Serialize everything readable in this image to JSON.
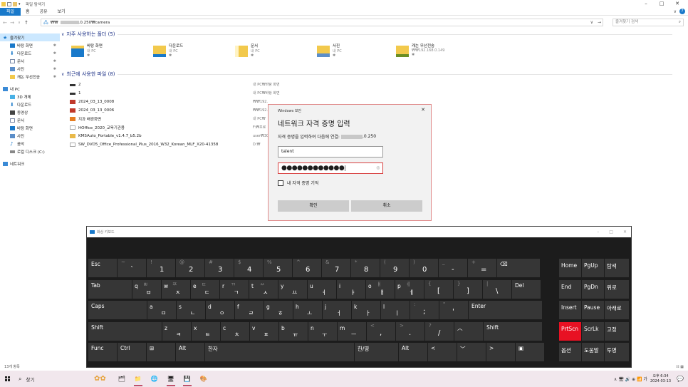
{
  "window": {
    "title": "파일 탐색기",
    "controls": [
      "–",
      "□",
      "✕"
    ]
  },
  "ribbon": {
    "tabs": [
      "파일",
      "홈",
      "공유",
      "보기"
    ],
    "expand": "∨",
    "help": "?"
  },
  "nav": {
    "back": "←",
    "forward": "→",
    "recent": "∨",
    "up": "↑",
    "address_prefix": "₩₩",
    "address_suffix": ".0.250₩camera",
    "dropdown": "∨",
    "refresh": "→",
    "search_placeholder": "즐겨찾기 검색",
    "search_icon": "⌕"
  },
  "sidebar": {
    "quick_access": "즐겨찾기",
    "quick_items": [
      "바탕 화면",
      "다운로드",
      "문서",
      "사진",
      "캐논 무선전송"
    ],
    "pin": "✱",
    "this_pc": "내 PC",
    "pc_items": [
      "3D 개체",
      "다운로드",
      "동영상",
      "문서",
      "바탕 화면",
      "사진",
      "음악",
      "로컬 디스크 (C:)"
    ],
    "network": "네트워크"
  },
  "frequent": {
    "header": "자주 사용하는 폴더 (5)",
    "folders": [
      {
        "name": "바탕 화면",
        "loc": "내 PC"
      },
      {
        "name": "다운로드",
        "loc": "내 PC"
      },
      {
        "name": "문서",
        "loc": "내 PC"
      },
      {
        "name": "사진",
        "loc": "내 PC"
      },
      {
        "name": "캐논 무선전송",
        "loc": "₩₩192.168.0.149"
      }
    ]
  },
  "recent": {
    "header": "최근에 사용한 파일 (8)",
    "files": [
      {
        "name": "2",
        "loc": "내 PC₩바탕 화면"
      },
      {
        "name": "1",
        "loc": "내 PC₩바탕 화면"
      },
      {
        "name": "2024_03_13_0008",
        "loc": "₩₩192."
      },
      {
        "name": "2024_03_13_0006",
        "loc": "₩₩192."
      },
      {
        "name": "지과 배경화면",
        "loc": "내 PC₩"
      },
      {
        "name": "HOffice_2020_교육기관용",
        "loc": "F:₩프로"
      },
      {
        "name": "KMSAuto_Portable_v1.4.7_b5.2b",
        "loc": "user₩30"
      },
      {
        "name": "SW_DVD5_Office_Professional_Plus_2016_W32_Korean_MLF_X20-41358",
        "loc": "D:₩"
      }
    ]
  },
  "status": {
    "count": "13개 항목",
    "views": "☷ ▦"
  },
  "dialog": {
    "title": "Windows 보안",
    "close": "✕",
    "heading": "네트워크 자격 증명 입력",
    "subtitle_prefix": "자격 증명을 입력하여 다음에 연결:",
    "subtitle_suffix": ".0.250",
    "username": "talent",
    "password_mask": "●●●●●●●●●●●●",
    "eye": "◎",
    "remember": "내 자격 증명 기억",
    "ok": "확인",
    "cancel": "취소"
  },
  "osk": {
    "title": "화상 키보드",
    "controls": [
      "–",
      "□",
      "✕"
    ],
    "rows": [
      [
        {
          "lbl": "Esc",
          "w": 40
        },
        {
          "sh": "~",
          "mn": "`",
          "w": 40
        },
        {
          "sh": "!",
          "mn": "1",
          "w": 40
        },
        {
          "sh": "@",
          "mn": "2",
          "w": 40
        },
        {
          "sh": "#",
          "mn": "3",
          "w": 40
        },
        {
          "sh": "$",
          "mn": "4",
          "w": 40
        },
        {
          "sh": "%",
          "mn": "5",
          "w": 40
        },
        {
          "sh": "^",
          "mn": "6",
          "w": 40
        },
        {
          "sh": "&",
          "mn": "7",
          "w": 40
        },
        {
          "sh": "*",
          "mn": "8",
          "w": 40
        },
        {
          "sh": "(",
          "mn": "9",
          "w": 40
        },
        {
          "sh": ")",
          "mn": "0",
          "w": 40
        },
        {
          "sh": "_",
          "mn": "-",
          "w": 40
        },
        {
          "sh": "+",
          "mn": "=",
          "w": 40
        },
        {
          "lbl": "⌫",
          "w": 60
        }
      ],
      [
        {
          "lbl": "Tab",
          "w": 61
        },
        {
          "lt": "q",
          "sh": "ㅃ",
          "hg": "ㅂ",
          "w": 40
        },
        {
          "lt": "w",
          "sh": "ㅉ",
          "hg": "ㅈ",
          "w": 40
        },
        {
          "lt": "e",
          "sh": "ㄸ",
          "hg": "ㄷ",
          "w": 40
        },
        {
          "lt": "r",
          "sh": "ㄲ",
          "hg": "ㄱ",
          "w": 40
        },
        {
          "lt": "t",
          "sh": "ㅆ",
          "hg": "ㅅ",
          "w": 40
        },
        {
          "lt": "y",
          "hg": "ㅛ",
          "w": 40
        },
        {
          "lt": "u",
          "hg": "ㅕ",
          "w": 40
        },
        {
          "lt": "i",
          "hg": "ㅑ",
          "w": 40
        },
        {
          "lt": "o",
          "sh": "ㅒ",
          "hg": "ㅐ",
          "w": 40
        },
        {
          "lt": "p",
          "sh": "ㅖ",
          "hg": "ㅔ",
          "w": 40
        },
        {
          "sh": "{",
          "mn": "[",
          "w": 40
        },
        {
          "sh": "}",
          "mn": "]",
          "w": 40
        },
        {
          "sh": "|",
          "mn": "\\",
          "w": 40
        },
        {
          "lbl": "Del",
          "w": 40
        }
      ],
      [
        {
          "lbl": "Caps",
          "w": 82
        },
        {
          "lt": "a",
          "hg": "ㅁ",
          "w": 40
        },
        {
          "lt": "s",
          "hg": "ㄴ",
          "w": 40
        },
        {
          "lt": "d",
          "hg": "ㅇ",
          "w": 40
        },
        {
          "lt": "f",
          "hg": "ㄹ",
          "w": 40
        },
        {
          "lt": "g",
          "hg": "ㅎ",
          "w": 40
        },
        {
          "lt": "h",
          "hg": "ㅗ",
          "w": 40
        },
        {
          "lt": "j",
          "hg": "ㅓ",
          "w": 40
        },
        {
          "lt": "k",
          "hg": "ㅏ",
          "w": 40
        },
        {
          "lt": "l",
          "hg": "ㅣ",
          "w": 40
        },
        {
          "sh": ":",
          "mn": ";",
          "w": 40
        },
        {
          "sh": "\"",
          "mn": "'",
          "w": 40
        },
        {
          "lbl": "Enter",
          "w": 103
        }
      ],
      [
        {
          "lbl": "Shift",
          "w": 103
        },
        {
          "lt": "z",
          "hg": "ㅋ",
          "w": 40
        },
        {
          "lt": "x",
          "hg": "ㅌ",
          "w": 40
        },
        {
          "lt": "c",
          "hg": "ㅊ",
          "w": 40
        },
        {
          "lt": "v",
          "hg": "ㅍ",
          "w": 40
        },
        {
          "lt": "b",
          "hg": "ㅠ",
          "w": 40
        },
        {
          "lt": "n",
          "hg": "ㅜ",
          "w": 40
        },
        {
          "lt": "m",
          "hg": "ㅡ",
          "w": 40
        },
        {
          "sh": "<",
          "mn": ",",
          "w": 40
        },
        {
          "sh": ">",
          "mn": ".",
          "w": 40
        },
        {
          "sh": "?",
          "mn": "/",
          "w": 40
        },
        {
          "lbl": "︿",
          "w": 40
        },
        {
          "lbl": "Shift",
          "w": 82
        }
      ],
      [
        {
          "lbl": "Func",
          "w": 40
        },
        {
          "lbl": "Ctrl",
          "w": 40
        },
        {
          "lbl": "⊞",
          "w": 40
        },
        {
          "lbl": "Alt",
          "w": 40
        },
        {
          "lbl": "한자",
          "w": 209
        },
        {
          "lbl": "한/영",
          "w": 61
        },
        {
          "lbl": "Alt",
          "w": 40
        },
        {
          "lbl": "<",
          "w": 40
        },
        {
          "lbl": "﹀",
          "w": 40
        },
        {
          "lbl": ">",
          "w": 40
        },
        {
          "lbl": "▣",
          "w": 40
        }
      ]
    ],
    "side_rows": [
      [
        "Home",
        "PgUp",
        "탐색"
      ],
      [
        "End",
        "PgDn",
        "위로"
      ],
      [
        "Insert",
        "Pause",
        "아래로"
      ],
      [
        "PrtScn",
        "ScrLk",
        "고정"
      ],
      [
        "옵션",
        "도움말",
        "투명"
      ]
    ],
    "highlight_key": "PrtScn"
  },
  "taskbar": {
    "search": "찾기",
    "apps": [
      "🗂",
      "📁",
      "🌐",
      "🖥",
      "💾",
      "🎨"
    ],
    "tray": "∧  🖥  🔊  ⊕  📶  가",
    "time": "오후 6:34",
    "date": "2024-03-13",
    "notify": "💬"
  },
  "colors": {
    "accent": "#1979ca",
    "folder": "#f2c94c",
    "danger": "#e81123"
  }
}
